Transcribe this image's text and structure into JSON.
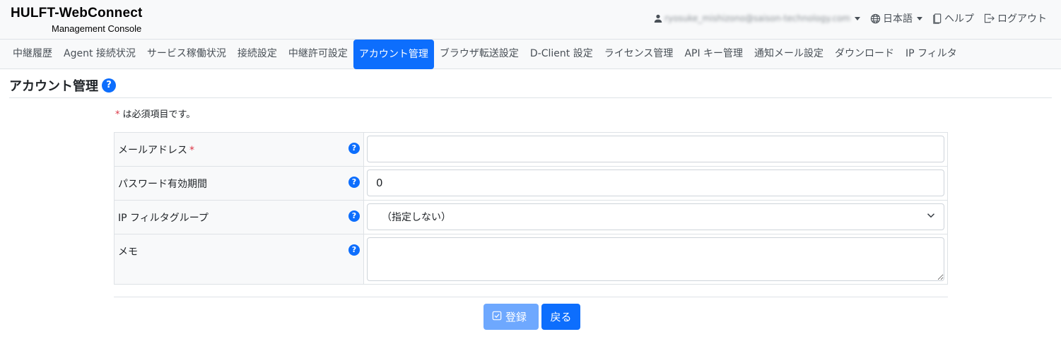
{
  "header": {
    "brand_title": "HULFT-WebConnect",
    "brand_subtitle": "Management Console",
    "user_email": "ryosuke_mishizono@saison-technology.com",
    "language": "日本語",
    "help_label": "ヘルプ",
    "logout_label": "ログアウト"
  },
  "tabs": [
    {
      "label": "中継履歴",
      "active": false
    },
    {
      "label": "Agent 接続状況",
      "active": false
    },
    {
      "label": "サービス稼働状況",
      "active": false
    },
    {
      "label": "接続設定",
      "active": false
    },
    {
      "label": "中継許可設定",
      "active": false
    },
    {
      "label": "アカウント管理",
      "active": true
    },
    {
      "label": "ブラウザ転送設定",
      "active": false
    },
    {
      "label": "D-Client 設定",
      "active": false
    },
    {
      "label": "ライセンス管理",
      "active": false
    },
    {
      "label": "API キー管理",
      "active": false
    },
    {
      "label": "通知メール設定",
      "active": false
    },
    {
      "label": "ダウンロード",
      "active": false
    },
    {
      "label": "IP フィルタ",
      "active": false
    }
  ],
  "page": {
    "title": "アカウント管理",
    "help_icon": "?",
    "required_star": "*",
    "required_note": "は必須項目です。"
  },
  "form": {
    "email_label": "メールアドレス",
    "email_required": "*",
    "email_value": "",
    "password_expiry_label": "パスワード有効期間",
    "password_expiry_value": "0",
    "ip_filter_label": "IP フィルタグループ",
    "ip_filter_selected": "（指定しない）",
    "memo_label": "メモ",
    "memo_value": "",
    "field_help": "?"
  },
  "buttons": {
    "register_label": "登録",
    "back_label": "戻る"
  },
  "colors": {
    "primary": "#0d6efd",
    "primary_disabled": "#6ea8fe",
    "required": "#dc3545"
  }
}
